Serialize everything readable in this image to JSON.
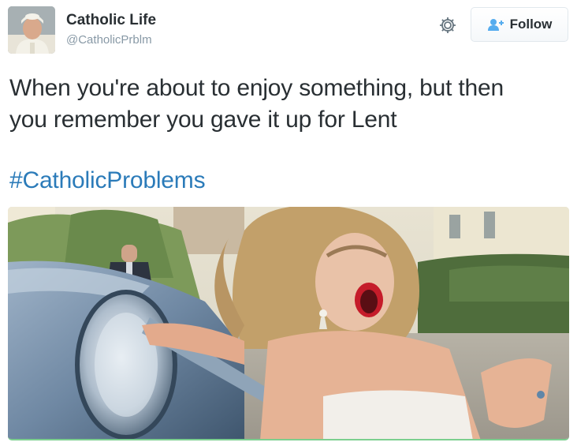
{
  "tweet": {
    "author": {
      "name": "Catholic Life",
      "handle": "@CatholicPrblm"
    },
    "follow_label": "Follow",
    "text_lines": [
      "When you're about to enjoy something, but then",
      "you remember you gave it up for Lent"
    ],
    "hashtag": "#CatholicProblems",
    "colors": {
      "hashtag": "#2b7bb9",
      "text": "#292f33",
      "handle": "#8899a6",
      "follow_icon": "#55acee"
    },
    "icons": {
      "settings": "gear-icon",
      "follow": "add-user-icon"
    }
  }
}
